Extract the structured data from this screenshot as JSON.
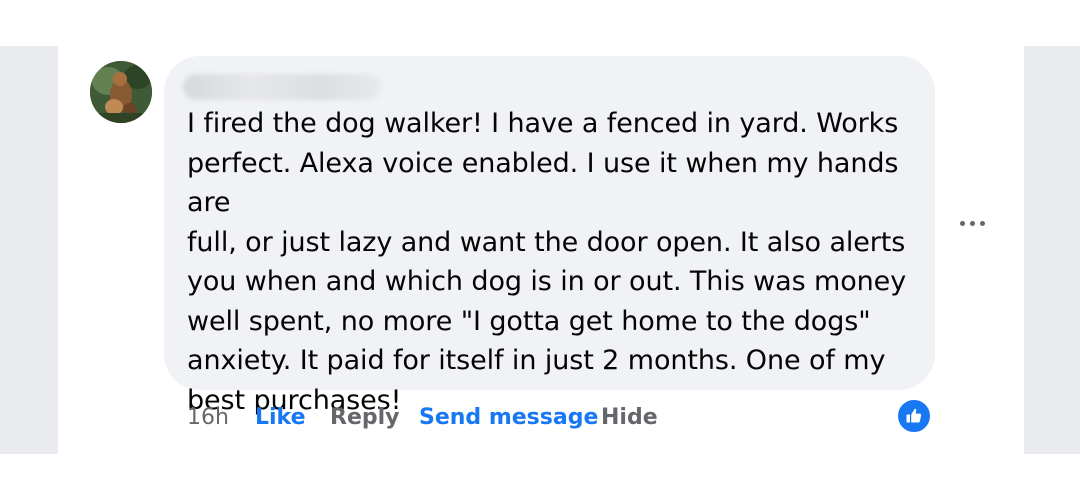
{
  "comment": {
    "author_name_hidden": true,
    "text": "I fired the dog walker! I have a fenced in yard. Works\nperfect. Alexa voice enabled. I use it when my hands are\nfull, or just lazy and want the door open. It also alerts\nyou when and which dog is in or out. This was money\nwell spent, no more \"I gotta get home to the dogs\"\nanxiety. It paid for itself in just 2 months. One of my\nbest purchases!"
  },
  "actions": {
    "timestamp": "16h",
    "like_label": "Like",
    "reply_label": "Reply",
    "send_message_label": "Send message",
    "hide_label": "Hide"
  },
  "icons": {
    "more": "more-options-icon",
    "reaction": "thumbs-up-icon"
  },
  "colors": {
    "accent": "#1877f2",
    "secondary_text": "#65676b",
    "bubble_bg": "#f0f2f5",
    "text": "#050505"
  }
}
